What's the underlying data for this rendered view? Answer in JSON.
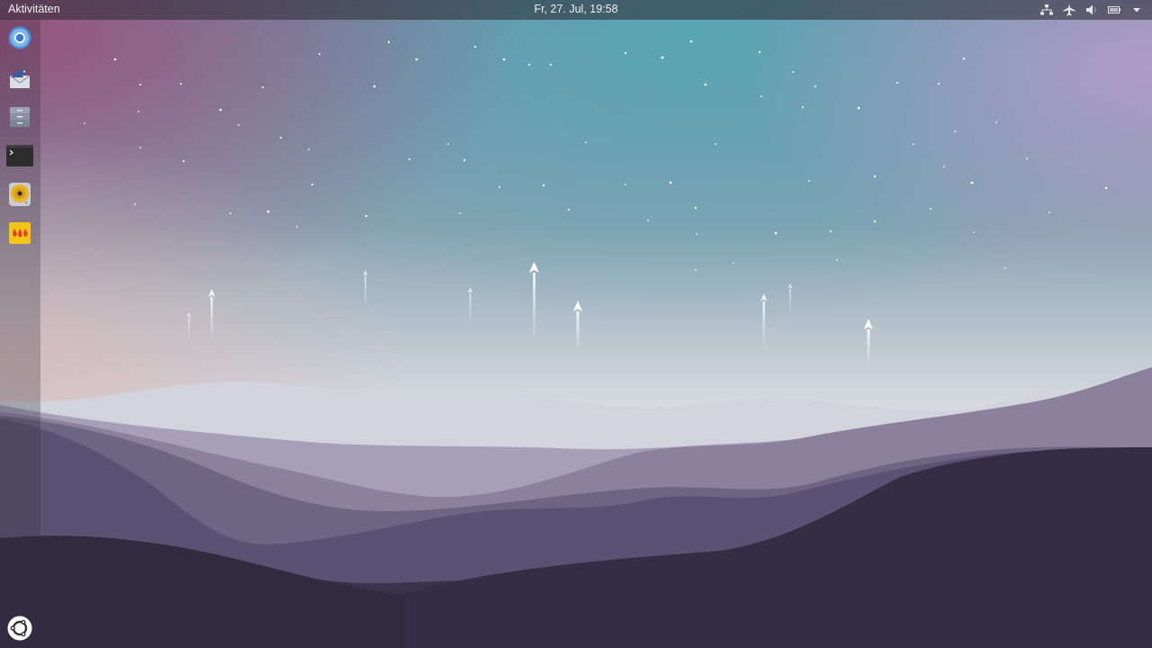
{
  "topbar": {
    "activities_label": "Aktivitäten",
    "clock": "Fr, 27. Jul, 19:58",
    "tray_icons": [
      "network-icon",
      "airplane-mode-icon",
      "volume-icon",
      "battery-icon",
      "system-menu-chevron-icon"
    ]
  },
  "dock": {
    "apps": [
      "chromium-icon",
      "bird-mail-icon",
      "file-manager-icon",
      "terminal-icon",
      "disc-player-icon",
      "game-icon"
    ],
    "show_applications_icon": "ubuntu-logo-icon"
  },
  "colors": {
    "topbar_bg": "#2e2d36",
    "sky_top_left": "#8a5a80",
    "sky_top_center": "#63a6b4",
    "sky_top_right": "#a890c0",
    "mountain_dark": "#2f2940"
  }
}
